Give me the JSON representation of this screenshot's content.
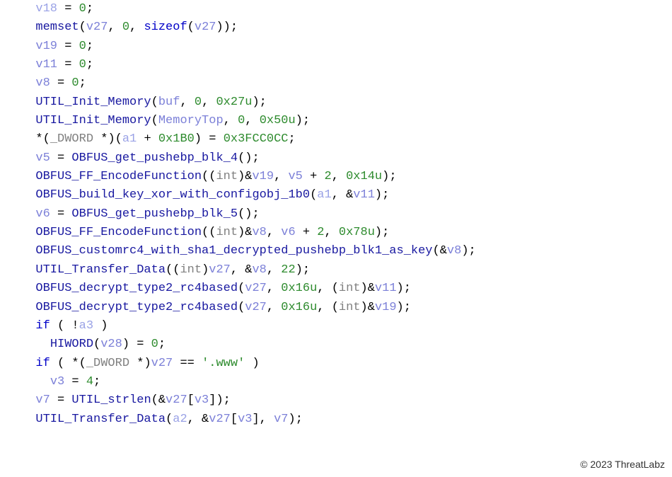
{
  "watermark": "© 2023 ThreatLabz",
  "code": {
    "lines": [
      [
        {
          "t": "  ",
          "c": "op"
        },
        {
          "t": "v18",
          "c": "varhi"
        },
        {
          "t": " = ",
          "c": "op"
        },
        {
          "t": "0",
          "c": "num"
        },
        {
          "t": ";",
          "c": "op"
        }
      ],
      [
        {
          "t": "  ",
          "c": "op"
        },
        {
          "t": "memset",
          "c": "ident-bl"
        },
        {
          "t": "(",
          "c": "op"
        },
        {
          "t": "v27",
          "c": "var"
        },
        {
          "t": ", ",
          "c": "op"
        },
        {
          "t": "0",
          "c": "num"
        },
        {
          "t": ", ",
          "c": "op"
        },
        {
          "t": "sizeof",
          "c": "kw"
        },
        {
          "t": "(",
          "c": "op"
        },
        {
          "t": "v27",
          "c": "var"
        },
        {
          "t": "));",
          "c": "op"
        }
      ],
      [
        {
          "t": "  ",
          "c": "op"
        },
        {
          "t": "v19",
          "c": "var"
        },
        {
          "t": " = ",
          "c": "op"
        },
        {
          "t": "0",
          "c": "num"
        },
        {
          "t": ";",
          "c": "op"
        }
      ],
      [
        {
          "t": "  ",
          "c": "op"
        },
        {
          "t": "v11",
          "c": "var"
        },
        {
          "t": " = ",
          "c": "op"
        },
        {
          "t": "0",
          "c": "num"
        },
        {
          "t": ";",
          "c": "op"
        }
      ],
      [
        {
          "t": "  ",
          "c": "op"
        },
        {
          "t": "v8",
          "c": "var"
        },
        {
          "t": " = ",
          "c": "op"
        },
        {
          "t": "0",
          "c": "num"
        },
        {
          "t": ";",
          "c": "op"
        }
      ],
      [
        {
          "t": "  ",
          "c": "op"
        },
        {
          "t": "UTIL_Init_Memory",
          "c": "fn"
        },
        {
          "t": "(",
          "c": "op"
        },
        {
          "t": "buf",
          "c": "var"
        },
        {
          "t": ", ",
          "c": "op"
        },
        {
          "t": "0",
          "c": "num"
        },
        {
          "t": ", ",
          "c": "op"
        },
        {
          "t": "0x27u",
          "c": "hex"
        },
        {
          "t": ");",
          "c": "op"
        }
      ],
      [
        {
          "t": "  ",
          "c": "op"
        },
        {
          "t": "UTIL_Init_Memory",
          "c": "fn"
        },
        {
          "t": "(",
          "c": "op"
        },
        {
          "t": "MemoryTop",
          "c": "var"
        },
        {
          "t": ", ",
          "c": "op"
        },
        {
          "t": "0",
          "c": "num"
        },
        {
          "t": ", ",
          "c": "op"
        },
        {
          "t": "0x50u",
          "c": "hex"
        },
        {
          "t": ");",
          "c": "op"
        }
      ],
      [
        {
          "t": "  *(",
          "c": "op"
        },
        {
          "t": "_DWORD ",
          "c": "type"
        },
        {
          "t": "*",
          "c": "op"
        },
        {
          "t": ")(",
          "c": "op"
        },
        {
          "t": "a1",
          "c": "varhi"
        },
        {
          "t": " + ",
          "c": "op"
        },
        {
          "t": "0x1B0",
          "c": "hex"
        },
        {
          "t": ") = ",
          "c": "op"
        },
        {
          "t": "0x3FCC0CC",
          "c": "hex"
        },
        {
          "t": ";",
          "c": "op"
        }
      ],
      [
        {
          "t": "  ",
          "c": "op"
        },
        {
          "t": "v5",
          "c": "var"
        },
        {
          "t": " = ",
          "c": "op"
        },
        {
          "t": "OBFUS_get_pushebp_blk_4",
          "c": "fn"
        },
        {
          "t": "();",
          "c": "op"
        }
      ],
      [
        {
          "t": "  ",
          "c": "op"
        },
        {
          "t": "OBFUS_FF_EncodeFunction",
          "c": "fn"
        },
        {
          "t": "((",
          "c": "op"
        },
        {
          "t": "int",
          "c": "type"
        },
        {
          "t": ")&",
          "c": "op"
        },
        {
          "t": "v19",
          "c": "var"
        },
        {
          "t": ", ",
          "c": "op"
        },
        {
          "t": "v5",
          "c": "var"
        },
        {
          "t": " + ",
          "c": "op"
        },
        {
          "t": "2",
          "c": "num"
        },
        {
          "t": ", ",
          "c": "op"
        },
        {
          "t": "0x14u",
          "c": "hex"
        },
        {
          "t": ");",
          "c": "op"
        }
      ],
      [
        {
          "t": "  ",
          "c": "op"
        },
        {
          "t": "OBFUS_build_key_xor_with_configobj_1b0",
          "c": "fn"
        },
        {
          "t": "(",
          "c": "op"
        },
        {
          "t": "a1",
          "c": "varhi"
        },
        {
          "t": ", &",
          "c": "op"
        },
        {
          "t": "v11",
          "c": "var"
        },
        {
          "t": ");",
          "c": "op"
        }
      ],
      [
        {
          "t": "  ",
          "c": "op"
        },
        {
          "t": "v6",
          "c": "var"
        },
        {
          "t": " = ",
          "c": "op"
        },
        {
          "t": "OBFUS_get_pushebp_blk_5",
          "c": "fn"
        },
        {
          "t": "();",
          "c": "op"
        }
      ],
      [
        {
          "t": "  ",
          "c": "op"
        },
        {
          "t": "OBFUS_FF_EncodeFunction",
          "c": "fn"
        },
        {
          "t": "((",
          "c": "op"
        },
        {
          "t": "int",
          "c": "type"
        },
        {
          "t": ")&",
          "c": "op"
        },
        {
          "t": "v8",
          "c": "var"
        },
        {
          "t": ", ",
          "c": "op"
        },
        {
          "t": "v6",
          "c": "var"
        },
        {
          "t": " + ",
          "c": "op"
        },
        {
          "t": "2",
          "c": "num"
        },
        {
          "t": ", ",
          "c": "op"
        },
        {
          "t": "0x78u",
          "c": "hex"
        },
        {
          "t": ");",
          "c": "op"
        }
      ],
      [
        {
          "t": "  ",
          "c": "op"
        },
        {
          "t": "OBFUS_customrc4_with_sha1_decrypted_pushebp_blk1_as_key",
          "c": "fn"
        },
        {
          "t": "(&",
          "c": "op"
        },
        {
          "t": "v8",
          "c": "var"
        },
        {
          "t": ");",
          "c": "op"
        }
      ],
      [
        {
          "t": "  ",
          "c": "op"
        },
        {
          "t": "UTIL_Transfer_Data",
          "c": "fn"
        },
        {
          "t": "((",
          "c": "op"
        },
        {
          "t": "int",
          "c": "type"
        },
        {
          "t": ")",
          "c": "op"
        },
        {
          "t": "v27",
          "c": "var"
        },
        {
          "t": ", &",
          "c": "op"
        },
        {
          "t": "v8",
          "c": "var"
        },
        {
          "t": ", ",
          "c": "op"
        },
        {
          "t": "22",
          "c": "num"
        },
        {
          "t": ");",
          "c": "op"
        }
      ],
      [
        {
          "t": "  ",
          "c": "op"
        },
        {
          "t": "OBFUS_decrypt_type2_rc4based",
          "c": "fn"
        },
        {
          "t": "(",
          "c": "op"
        },
        {
          "t": "v27",
          "c": "var"
        },
        {
          "t": ", ",
          "c": "op"
        },
        {
          "t": "0x16u",
          "c": "hex"
        },
        {
          "t": ", (",
          "c": "op"
        },
        {
          "t": "int",
          "c": "type"
        },
        {
          "t": ")&",
          "c": "op"
        },
        {
          "t": "v11",
          "c": "var"
        },
        {
          "t": ");",
          "c": "op"
        }
      ],
      [
        {
          "t": "  ",
          "c": "op"
        },
        {
          "t": "OBFUS_decrypt_type2_rc4based",
          "c": "fn"
        },
        {
          "t": "(",
          "c": "op"
        },
        {
          "t": "v27",
          "c": "var"
        },
        {
          "t": ", ",
          "c": "op"
        },
        {
          "t": "0x16u",
          "c": "hex"
        },
        {
          "t": ", (",
          "c": "op"
        },
        {
          "t": "int",
          "c": "type"
        },
        {
          "t": ")&",
          "c": "op"
        },
        {
          "t": "v19",
          "c": "var"
        },
        {
          "t": ");",
          "c": "op"
        }
      ],
      [
        {
          "t": "  ",
          "c": "op"
        },
        {
          "t": "if",
          "c": "kw"
        },
        {
          "t": " ( !",
          "c": "op"
        },
        {
          "t": "a3",
          "c": "varhi"
        },
        {
          "t": " )",
          "c": "op"
        }
      ],
      [
        {
          "t": "    ",
          "c": "op"
        },
        {
          "t": "HIWORD",
          "c": "fn"
        },
        {
          "t": "(",
          "c": "op"
        },
        {
          "t": "v28",
          "c": "var"
        },
        {
          "t": ") = ",
          "c": "op"
        },
        {
          "t": "0",
          "c": "num"
        },
        {
          "t": ";",
          "c": "op"
        }
      ],
      [
        {
          "t": "  ",
          "c": "op"
        },
        {
          "t": "if",
          "c": "kw"
        },
        {
          "t": " ( *(",
          "c": "op"
        },
        {
          "t": "_DWORD ",
          "c": "type"
        },
        {
          "t": "*",
          "c": "op"
        },
        {
          "t": ")",
          "c": "op"
        },
        {
          "t": "v27",
          "c": "var"
        },
        {
          "t": " == ",
          "c": "op"
        },
        {
          "t": "'.www'",
          "c": "str"
        },
        {
          "t": " )",
          "c": "op"
        }
      ],
      [
        {
          "t": "    ",
          "c": "op"
        },
        {
          "t": "v3",
          "c": "var"
        },
        {
          "t": " = ",
          "c": "op"
        },
        {
          "t": "4",
          "c": "num"
        },
        {
          "t": ";",
          "c": "op"
        }
      ],
      [
        {
          "t": "  ",
          "c": "op"
        },
        {
          "t": "v7",
          "c": "var"
        },
        {
          "t": " = ",
          "c": "op"
        },
        {
          "t": "UTIL_strlen",
          "c": "fn"
        },
        {
          "t": "(&",
          "c": "op"
        },
        {
          "t": "v27",
          "c": "var"
        },
        {
          "t": "[",
          "c": "op"
        },
        {
          "t": "v3",
          "c": "var"
        },
        {
          "t": "]);",
          "c": "op"
        }
      ],
      [
        {
          "t": "  ",
          "c": "op"
        },
        {
          "t": "UTIL_Transfer_Data",
          "c": "fn"
        },
        {
          "t": "(",
          "c": "op"
        },
        {
          "t": "a2",
          "c": "varhi"
        },
        {
          "t": ", &",
          "c": "op"
        },
        {
          "t": "v27",
          "c": "var"
        },
        {
          "t": "[",
          "c": "op"
        },
        {
          "t": "v3",
          "c": "var"
        },
        {
          "t": "], ",
          "c": "op"
        },
        {
          "t": "v7",
          "c": "var"
        },
        {
          "t": ");",
          "c": "op"
        }
      ]
    ]
  }
}
